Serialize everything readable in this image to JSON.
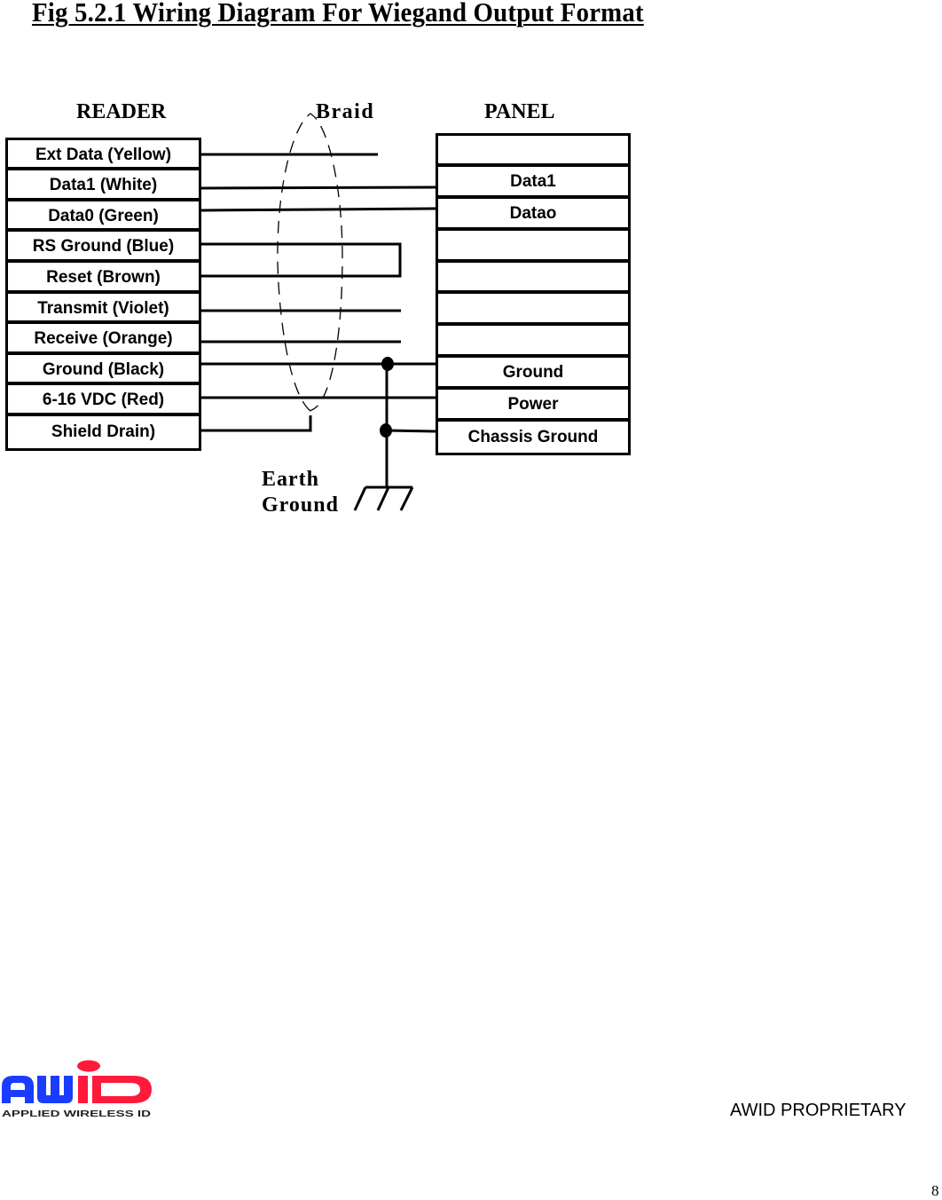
{
  "title": "Fig 5.2.1 Wiring Diagram For Wiegand Output Format",
  "headers": {
    "reader": "READER",
    "braid": "Braid",
    "panel": "PANEL"
  },
  "reader_terminals": [
    {
      "label": "Ext Data  (Yellow)"
    },
    {
      "label": "Data1 (White)"
    },
    {
      "label": "Data0 (Green)"
    },
    {
      "label": "RS Ground (Blue)"
    },
    {
      "label": "Reset (Brown)"
    },
    {
      "label": "Transmit (Violet)"
    },
    {
      "label": "Receive (Orange)"
    },
    {
      "label": "Ground (Black)"
    },
    {
      "label": "6-16 VDC (Red)"
    },
    {
      "label": "Shield Drain)"
    }
  ],
  "panel_terminals": [
    {
      "label": ""
    },
    {
      "label": "Data1"
    },
    {
      "label": "Datao"
    },
    {
      "label": ""
    },
    {
      "label": ""
    },
    {
      "label": ""
    },
    {
      "label": ""
    },
    {
      "label": "Ground"
    },
    {
      "label": "Power"
    },
    {
      "label": "Chassis Ground"
    }
  ],
  "connections": [
    {
      "from": "Ext Data  (Yellow)",
      "to": null,
      "note": "unterminated"
    },
    {
      "from": "Data1 (White)",
      "to": "Data1"
    },
    {
      "from": "Data0 (Green)",
      "to": "Datao"
    },
    {
      "from": "RS Ground (Blue)",
      "to": "Reset (Brown)",
      "note": "jumpered together"
    },
    {
      "from": "Transmit (Violet)",
      "to": null,
      "note": "unterminated"
    },
    {
      "from": "Receive (Orange)",
      "to": null,
      "note": "unterminated"
    },
    {
      "from": "Ground (Black)",
      "to": "Ground",
      "note": "tied to earth ground"
    },
    {
      "from": "6-16 VDC (Red)",
      "to": "Power"
    },
    {
      "from": "Shield Drain)",
      "to": "Braid"
    },
    {
      "from": "Chassis Ground",
      "to": "Earth Ground"
    }
  ],
  "earth_ground_label": [
    "Earth",
    "Ground"
  ],
  "footer": {
    "logo_text": "AWID",
    "logo_subtitle": "APPLIED WIRELESS ID",
    "logo_colors": {
      "awi": "#1a3cff",
      "d": "#ff1a3c",
      "i_dot": "#ff1a3c"
    },
    "proprietary": "AWID PROPRIETARY",
    "page_number": "8"
  }
}
